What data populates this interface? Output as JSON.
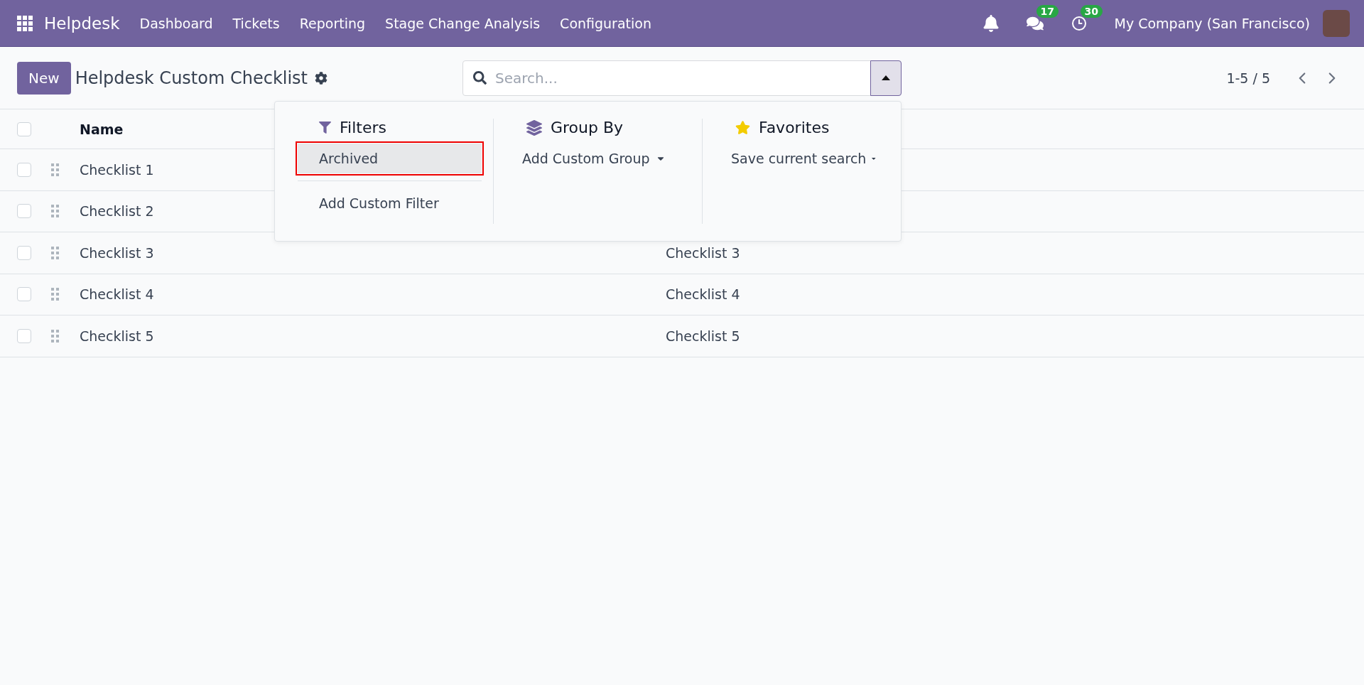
{
  "navbar": {
    "app_name": "Helpdesk",
    "menu": [
      "Dashboard",
      "Tickets",
      "Reporting",
      "Stage Change Analysis",
      "Configuration"
    ],
    "messages_badge": "17",
    "activities_badge": "30",
    "company": "My Company (San Francisco)"
  },
  "control_panel": {
    "new_button": "New",
    "title": "Helpdesk Custom Checklist",
    "search": {
      "placeholder": "Search..."
    },
    "pager": "1-5 / 5"
  },
  "search_panel": {
    "filters": {
      "title": "Filters",
      "items": [
        {
          "label": "Archived",
          "highlighted": true
        }
      ],
      "custom": "Add Custom Filter"
    },
    "group_by": {
      "title": "Group By",
      "custom": "Add Custom Group"
    },
    "favorites": {
      "title": "Favorites",
      "custom": "Save current search"
    }
  },
  "table": {
    "all_checked": false,
    "columns": [
      "Name"
    ],
    "rows": [
      {
        "name": "Checklist 1",
        "checked": false
      },
      {
        "name": "Checklist 2",
        "checked": false
      },
      {
        "name": "Checklist 3",
        "column_2": "Checklist 3",
        "checked": false
      },
      {
        "name": "Checklist 4",
        "column_2": "Checklist 4",
        "checked": false
      },
      {
        "name": "Checklist 5",
        "column_2": "Checklist 5",
        "checked": false
      }
    ]
  }
}
